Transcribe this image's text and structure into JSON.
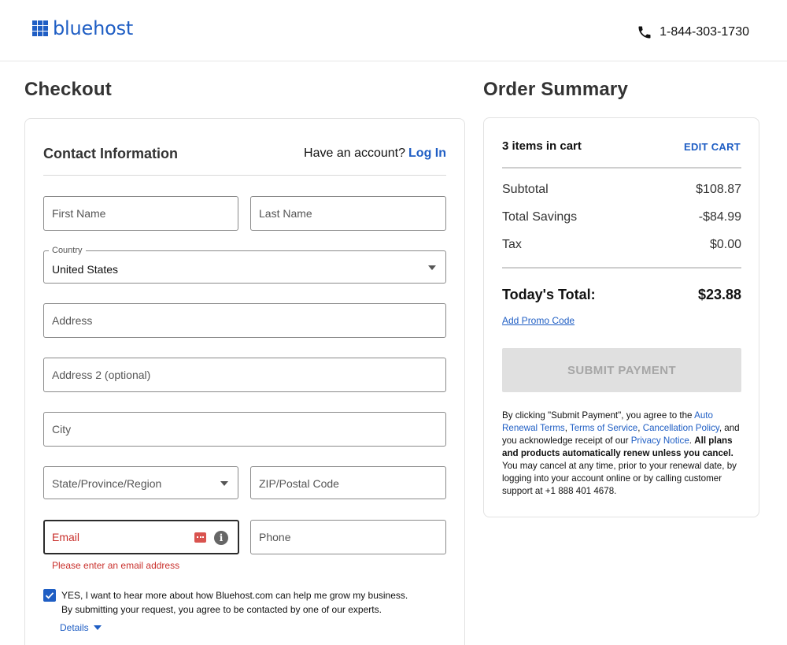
{
  "header": {
    "logo_text": "bluehost",
    "phone": "1-844-303-1730"
  },
  "checkout": {
    "title": "Checkout",
    "contact_title": "Contact Information",
    "have_account": "Have an account?",
    "login_label": "Log In",
    "fields": {
      "first_name": "First Name",
      "last_name": "Last Name",
      "country_label": "Country",
      "country_value": "United States",
      "address": "Address",
      "address2": "Address 2 (optional)",
      "city": "City",
      "state": "State/Province/Region",
      "zip": "ZIP/Postal Code",
      "email": "Email",
      "phone": "Phone"
    },
    "email_error": "Please enter an email address",
    "optin_checked": true,
    "optin_line1": "YES, I want to hear more about how Bluehost.com can help me grow my business.",
    "optin_line2": "By submitting your request, you agree to be contacted by one of our experts.",
    "details_label": "Details"
  },
  "order_summary": {
    "title": "Order Summary",
    "items_in_cart": "3 items in cart",
    "edit_cart": "EDIT CART",
    "subtotal_label": "Subtotal",
    "subtotal_value": "$108.87",
    "savings_label": "Total Savings",
    "savings_value": "-$84.99",
    "tax_label": "Tax",
    "tax_value": "$0.00",
    "total_label": "Today's Total:",
    "total_value": "$23.88",
    "promo_label": "Add Promo Code",
    "submit_label": "SUBMIT PAYMENT",
    "legal": {
      "p1": "By clicking \"Submit Payment\", you agree to the ",
      "auto_renewal": "Auto Renewal Terms",
      "sep1": ", ",
      "terms": "Terms of Service",
      "sep2": ", ",
      "cancellation": "Cancellation Policy",
      "p2": ", and you acknowledge receipt of our ",
      "privacy": "Privacy Notice",
      "p3": ". ",
      "bold": "All plans and products automatically renew unless you cancel.",
      "p4": " You may cancel at any time, prior to your renewal date, by logging into your account online or by calling customer support at +1 888 401 4678."
    }
  },
  "colors": {
    "brand_blue": "#1f5ec4",
    "error_red": "#c9302c",
    "disabled_button": "#e0e0e0"
  },
  "icons": [
    "phone-icon",
    "logo-grid-icon",
    "caret-down-icon",
    "error-badge-icon",
    "info-icon",
    "checkmark-icon"
  ]
}
